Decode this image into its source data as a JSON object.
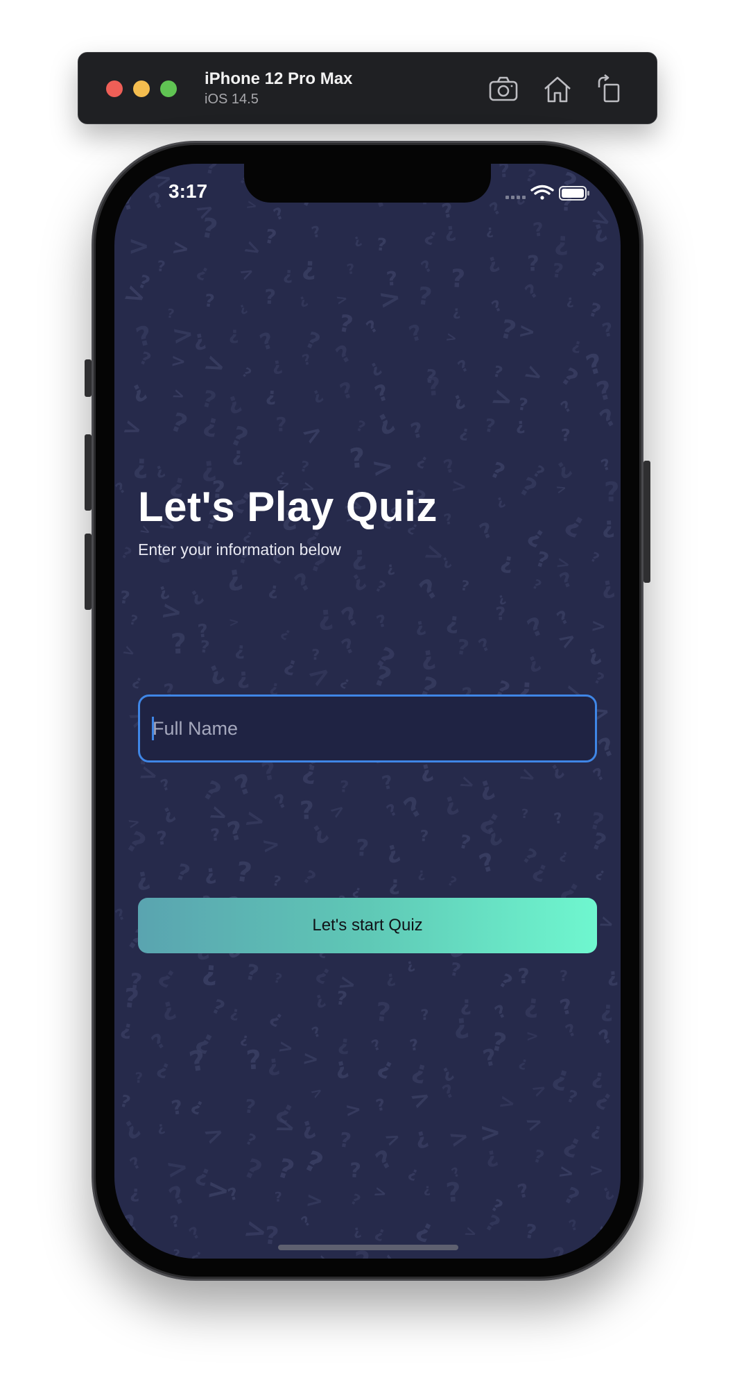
{
  "simulator": {
    "device_name": "iPhone 12 Pro Max",
    "os_version": "iOS 14.5",
    "icons": [
      "screenshot-icon",
      "home-icon",
      "rotate-icon"
    ]
  },
  "status_bar": {
    "time": "3:17",
    "icons": [
      "cellular-signal-icon",
      "wifi-icon",
      "battery-icon"
    ]
  },
  "main": {
    "title": "Let's Play Quiz",
    "subtitle": "Enter your information below",
    "name_field": {
      "placeholder": "Full Name",
      "value": ""
    },
    "start_button_label": "Let's start Quiz"
  },
  "colors": {
    "background": "#262a4b",
    "input_background": "#1f2343",
    "input_border": "#3f86e6",
    "button_gradient_start": "#5aa4b0",
    "button_gradient_end": "#6ff7cf"
  }
}
